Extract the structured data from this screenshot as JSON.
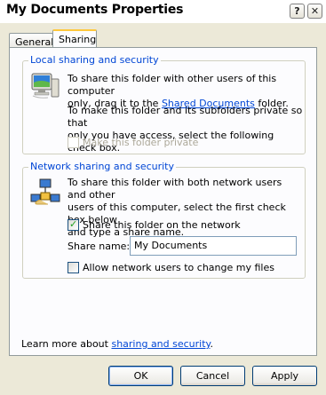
{
  "window": {
    "title": "My Documents Properties"
  },
  "titlebar": {
    "help_label": "?",
    "close_label": "✕"
  },
  "tabs": [
    {
      "label": "General"
    },
    {
      "label": "Sharing"
    }
  ],
  "local": {
    "legend": "Local sharing and security",
    "text1_line1": "To share this folder with other users of this computer",
    "text1_pre": "only, drag it to the ",
    "text1_link": "Shared Documents",
    "text1_post": " folder.",
    "text2_line1": "To make this folder and its subfolders private so that",
    "text2_line2": "only you have access, select the following check box.",
    "private_label": "Make this folder private",
    "private_checked": false
  },
  "network": {
    "legend": "Network sharing and security",
    "text_line1": "To share this folder with both network users and other",
    "text_line2": "users of this computer, select the first check box below",
    "text_line3": "and type a share name.",
    "share_label": "Share this folder on the network",
    "share_checked": true,
    "share_name_label": "Share name:",
    "share_name_value": "My Documents",
    "allow_change_label": "Allow network users to change my files",
    "allow_change_checked": false
  },
  "footer": {
    "learn_pre": "Learn more about ",
    "learn_link": "sharing and security",
    "learn_post": "."
  },
  "buttons": {
    "ok": "OK",
    "cancel": "Cancel",
    "apply": "Apply"
  },
  "colors": {
    "accent": "#0046d5",
    "tab_highlight": "#ffc83c",
    "dialog_bg": "#ece9d8"
  }
}
